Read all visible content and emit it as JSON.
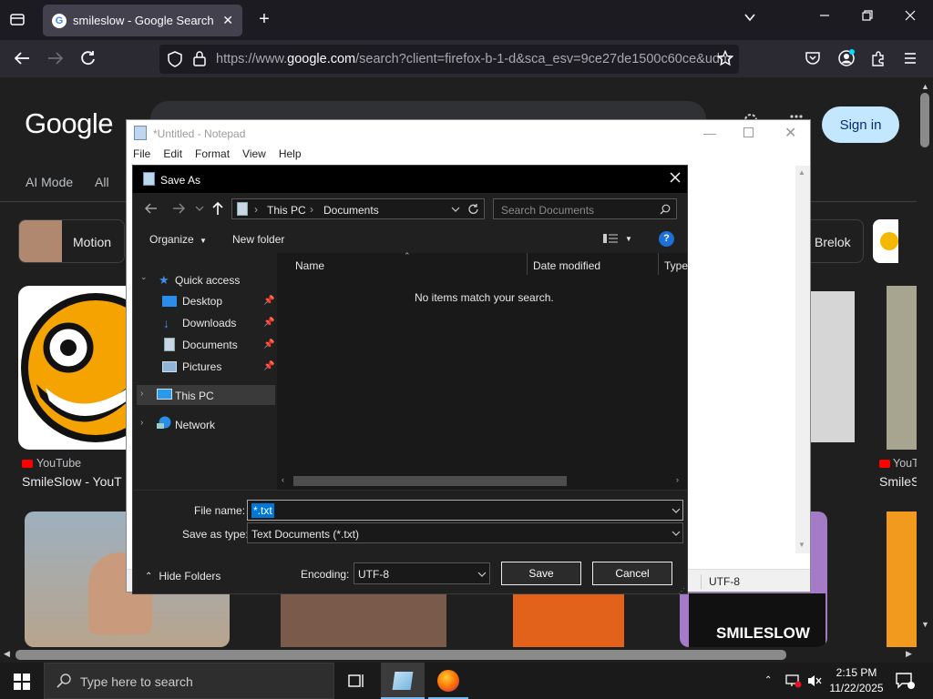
{
  "browser": {
    "tab_title": "smileslow - Google Search",
    "new_tab": "+",
    "url_prefix": "https://www.",
    "url_domain": "google.com",
    "url_rest": "/search?client=firefox-b-1-d&sca_esv=9ce27de1500c60ce&udm"
  },
  "google": {
    "logo": "Google",
    "sign_in": "Sign in",
    "tabs": [
      "AI Mode",
      "All"
    ],
    "chips": [
      "Motion",
      "Brelok"
    ],
    "result1": {
      "source": "YouTube",
      "title": "SmileSlow - YouT"
    },
    "result2": {
      "source": "YouT",
      "title": "SmileS"
    },
    "thumb_text": "SMILESLOW"
  },
  "notepad": {
    "title": "*Untitled - Notepad",
    "menu": [
      "File",
      "Edit",
      "Format",
      "View",
      "Help"
    ],
    "encoding_status": "UTF-8"
  },
  "save_dialog": {
    "title": "Save As",
    "breadcrumb": [
      "This PC",
      "Documents"
    ],
    "search_placeholder": "Search Documents",
    "organize": "Organize",
    "new_folder": "New folder",
    "nav_tree": [
      {
        "label": "Quick access",
        "icon": "star-icon"
      },
      {
        "label": "Desktop",
        "icon": "desktop-folder-icon"
      },
      {
        "label": "Downloads",
        "icon": "download-folder-icon"
      },
      {
        "label": "Documents",
        "icon": "documents-folder-icon"
      },
      {
        "label": "Pictures",
        "icon": "pictures-folder-icon"
      },
      {
        "label": "This PC",
        "icon": "computer-icon"
      },
      {
        "label": "Network",
        "icon": "network-icon"
      }
    ],
    "columns": [
      "Name",
      "Date modified",
      "Type"
    ],
    "empty_message": "No items match your search.",
    "file_name_label": "File name:",
    "file_name_value": "*.txt",
    "save_as_type_label": "Save as type:",
    "save_as_type_value": "Text Documents (*.txt)",
    "hide_folders": "Hide Folders",
    "encoding_label": "Encoding:",
    "encoding_value": "UTF-8",
    "save": "Save",
    "cancel": "Cancel"
  },
  "taskbar": {
    "search_placeholder": "Type here to search",
    "time": "2:15 PM",
    "date": "11/22/2025"
  },
  "colors": {
    "accent_selection": "#0078d7",
    "sign_in_bg": "#c2e7ff",
    "youtube_red": "#ff0000"
  }
}
